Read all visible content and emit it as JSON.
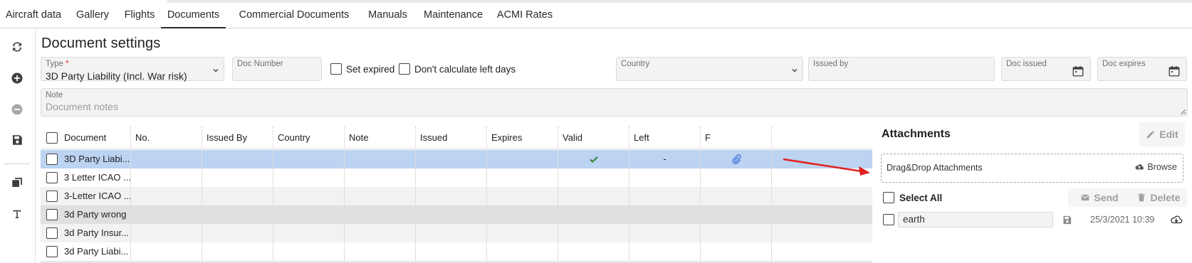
{
  "tabs": [
    {
      "label": "Aircraft data"
    },
    {
      "label": "Gallery"
    },
    {
      "label": "Flights"
    },
    {
      "label": "Documents"
    },
    {
      "label": "Commercial Documents"
    },
    {
      "label": "Manuals"
    },
    {
      "label": "Maintenance"
    },
    {
      "label": "ACMI Rates"
    }
  ],
  "active_tab": "Documents",
  "toolbar": [
    "refresh-icon",
    "add-icon",
    "remove-icon",
    "save-icon",
    "copy-icon",
    "text-icon"
  ],
  "page_title": "Document settings",
  "form": {
    "type_label": "Type",
    "type_required": "*",
    "type_value": "3D Party Liability (Incl. War risk)",
    "doc_number_label": "Doc Number",
    "set_expired_label": "Set expired",
    "dont_calc_label": "Don't calculate left days",
    "country_label": "Country",
    "issued_by_label": "Issued by",
    "doc_issued_label": "Doc issued",
    "doc_expires_label": "Doc expires",
    "note_label": "Note",
    "note_placeholder": "Document notes"
  },
  "grid": {
    "columns": [
      "Document",
      "No.",
      "Issued By",
      "Country",
      "Note",
      "Issued",
      "Expires",
      "Valid",
      "Left",
      "F"
    ],
    "rows": [
      {
        "document": "3D Party Liabi...",
        "valid": "check-icon",
        "left": "-",
        "file": "paperclip-icon",
        "selected": true
      },
      {
        "document": "3 Letter ICAO ..."
      },
      {
        "document": "3-Letter ICAO ..."
      },
      {
        "document": "3d Party wrong"
      },
      {
        "document": "3d Party Insur..."
      },
      {
        "document": "3d Party Liabi..."
      }
    ]
  },
  "attachments": {
    "title": "Attachments",
    "edit_label": "Edit",
    "dropzone_label": "Drag&Drop Attachments",
    "browse_label": "Browse",
    "select_all_label": "Select All",
    "send_label": "Send",
    "delete_label": "Delete",
    "files": [
      {
        "name": "earth",
        "date": "25/3/2021 10:39"
      }
    ]
  },
  "colors": {
    "selected_row": "#bcd3f2",
    "striped_row": "#f2f2f2",
    "dark_row": "#e0e0e0",
    "check_green": "#2e7d32",
    "clip_blue": "#3a6fd8",
    "arrow_red": "#e02020"
  }
}
